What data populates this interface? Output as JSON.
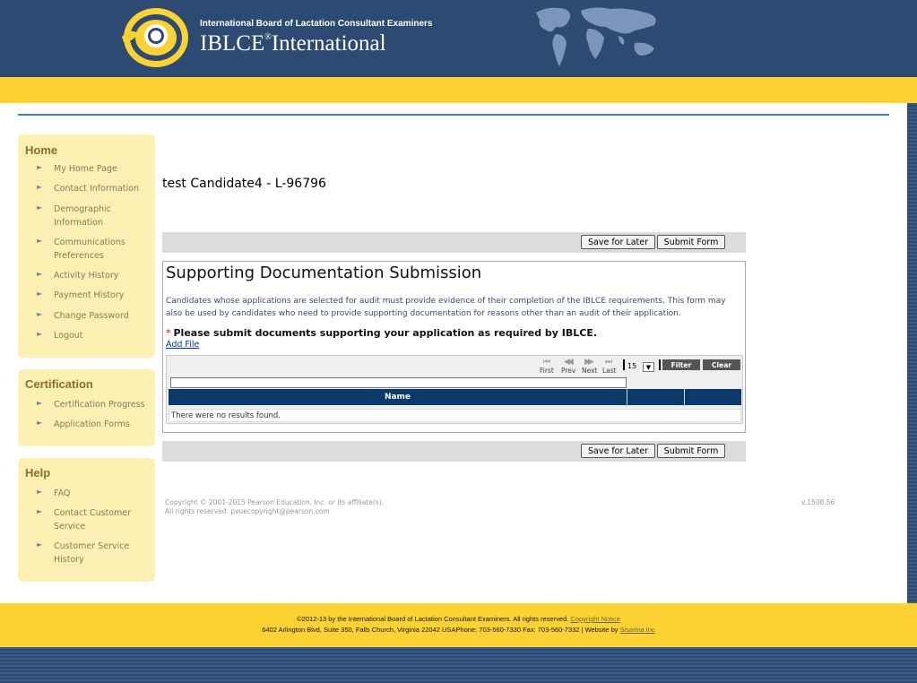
{
  "header": {
    "org_name": "International Board of Lactation Consultant Examiners",
    "brand_main": "IBLCE",
    "brand_mark": "®",
    "brand_tail": "International"
  },
  "colors": {
    "header_blue": "#2c4a72",
    "accent_yellow": "#fdd234",
    "sidebar_bg": "#fcefb2",
    "grid_header": "#0a3a6b"
  },
  "sidebar": {
    "home": {
      "heading": "Home",
      "items": [
        {
          "label": "My Home Page"
        },
        {
          "label": "Contact Information"
        },
        {
          "label": "Demographic Information"
        },
        {
          "label": "Communications Preferences"
        },
        {
          "label": "Activity History"
        },
        {
          "label": "Payment History"
        },
        {
          "label": "Change Password"
        },
        {
          "label": "Logout"
        }
      ]
    },
    "certification": {
      "heading": "Certification",
      "items": [
        {
          "label": "Certification Progress"
        },
        {
          "label": "Application Forms"
        }
      ]
    },
    "help": {
      "heading": "Help",
      "items": [
        {
          "label": "FAQ"
        },
        {
          "label": "Contact Customer Service"
        },
        {
          "label": "Customer Service History"
        }
      ]
    },
    "arrow_glyph": "►"
  },
  "main": {
    "title": "test Candidate4 - L-96796",
    "buttons": {
      "save": "Save for Later",
      "submit": "Submit Form"
    },
    "panel": {
      "title": "Supporting Documentation Submission",
      "description": "Candidates whose applications are selected for audit must provide evidence of their completion of the IBLCE requirements. This form may also be used by candidates who need to provide supporting documentation for reasons other than an audit of their application.",
      "required_star": "*",
      "required_text": "Please submit documents supporting your application as required by IBLCE.",
      "add_file": "Add File"
    },
    "grid": {
      "pager": {
        "first": "First",
        "prev": "Prev",
        "next": "Next",
        "last": "Last",
        "first_icon": "⏮",
        "prev_icon": "◀◀",
        "next_icon": "▶▶",
        "last_icon": "⏭"
      },
      "page_size": "15",
      "dropdown_icon": "▼",
      "filter": "Filter",
      "clear": "Clear",
      "columns": [
        "Name"
      ],
      "empty_message": "There were no results found."
    }
  },
  "copyright": {
    "line1": "Copyright © 2001-2015 Pearson Education, Inc. or its affiliate(s).",
    "line2": "All rights reserved. pvuecopyright@pearson.com",
    "version": "v.1508.56"
  },
  "footer": {
    "line1_text": "©2012-13 by the International Board of Lactation Consultant Examiners. All rights reserved.",
    "line1_link": "Copyright Notice",
    "line2_text": "6402 Arlington Blvd, Suite 350, Falls Church, Virginia 22042 USAPhone: 703-560-7330 Fax: 703-560-7332 | Website by",
    "line2_link": "Sisarina Inc"
  }
}
